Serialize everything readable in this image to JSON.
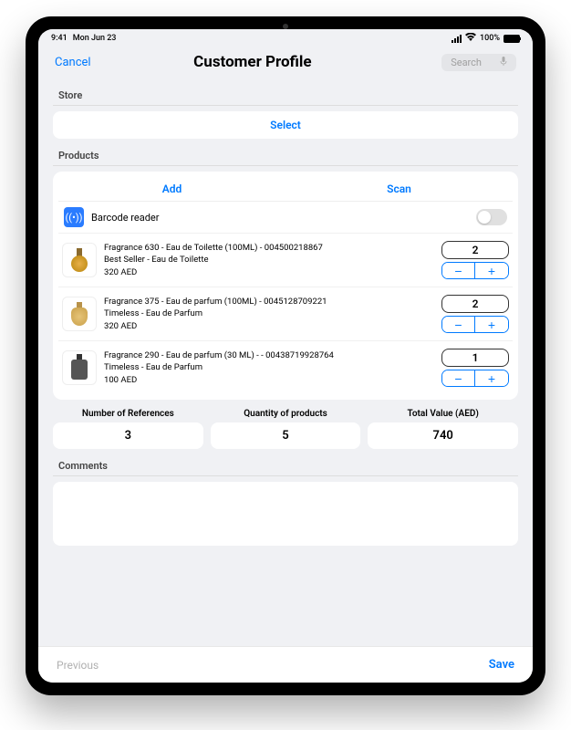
{
  "status": {
    "time": "9:41",
    "date": "Mon Jun 23",
    "battery": "100%"
  },
  "nav": {
    "cancel": "Cancel",
    "title": "Customer Profile",
    "search_ph": "Search"
  },
  "store": {
    "label": "Store",
    "select": "Select"
  },
  "products": {
    "label": "Products",
    "add": "Add",
    "scan": "Scan",
    "barcode": "Barcode reader",
    "items": [
      {
        "line1": "Fragrance 630 - Eau de Toilette (100ML) - 004500218867",
        "line2": "Best Seller - Eau de Toilette",
        "price": "320 AED",
        "qty": "2"
      },
      {
        "line1": "Fragrance 375 - Eau de parfum (100ML) - 0045128709221",
        "line2": "Timeless - Eau de Parfum",
        "price": "320 AED",
        "qty": "2"
      },
      {
        "line1": "Fragrance 290 - Eau de parfum (30 ML) - - 00438719928764",
        "line2": "Timeless - Eau de Parfum",
        "price": "100 AED",
        "qty": "1"
      }
    ]
  },
  "summary": {
    "refs_label": "Number of References",
    "refs": "3",
    "qty_label": "Quantity of products",
    "qty": "5",
    "total_label": "Total Value (AED)",
    "total": "740"
  },
  "comments_label": "Comments",
  "footer": {
    "prev": "Previous",
    "save": "Save"
  }
}
